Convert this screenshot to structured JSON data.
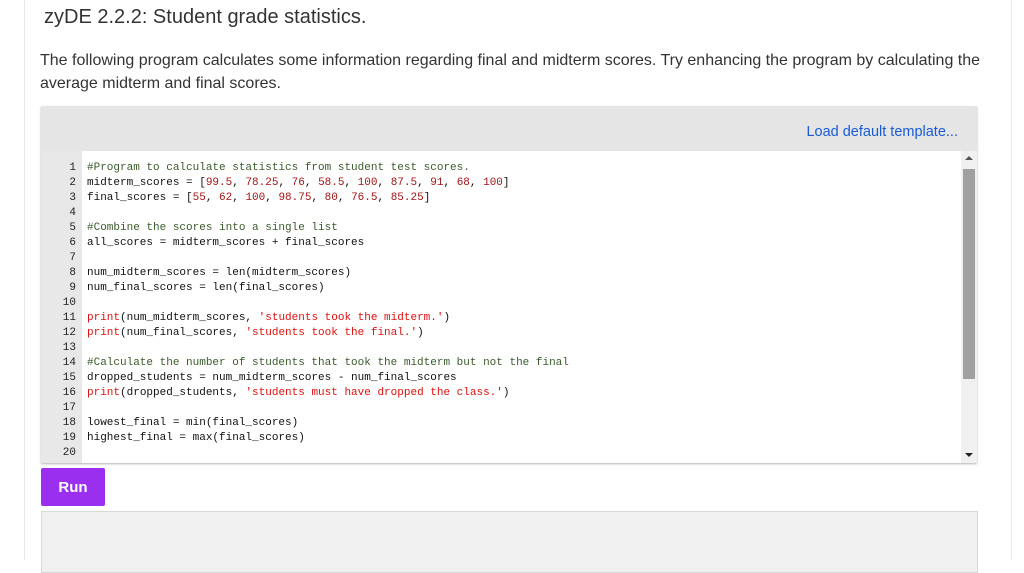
{
  "title": "zyDE 2.2.2: Student grade statistics.",
  "description": "The following program calculates some information regarding final and midterm scores. Try enhancing the program by calculating the average midterm and final scores.",
  "editor": {
    "load_template_label": "Load default template...",
    "lines": [
      [
        [
          "c",
          "#Program to calculate statistics from student test scores."
        ]
      ],
      [
        [
          "p",
          "midterm_scores = ["
        ],
        [
          "n",
          "99.5"
        ],
        [
          "p",
          ", "
        ],
        [
          "n",
          "78.25"
        ],
        [
          "p",
          ", "
        ],
        [
          "n",
          "76"
        ],
        [
          "p",
          ", "
        ],
        [
          "n",
          "58.5"
        ],
        [
          "p",
          ", "
        ],
        [
          "n",
          "100"
        ],
        [
          "p",
          ", "
        ],
        [
          "n",
          "87.5"
        ],
        [
          "p",
          ", "
        ],
        [
          "n",
          "91"
        ],
        [
          "p",
          ", "
        ],
        [
          "n",
          "68"
        ],
        [
          "p",
          ", "
        ],
        [
          "n",
          "100"
        ],
        [
          "p",
          "]"
        ]
      ],
      [
        [
          "p",
          "final_scores = ["
        ],
        [
          "n",
          "55"
        ],
        [
          "p",
          ", "
        ],
        [
          "n",
          "62"
        ],
        [
          "p",
          ", "
        ],
        [
          "n",
          "100"
        ],
        [
          "p",
          ", "
        ],
        [
          "n",
          "98.75"
        ],
        [
          "p",
          ", "
        ],
        [
          "n",
          "80"
        ],
        [
          "p",
          ", "
        ],
        [
          "n",
          "76.5"
        ],
        [
          "p",
          ", "
        ],
        [
          "n",
          "85.25"
        ],
        [
          "p",
          "]"
        ]
      ],
      [],
      [
        [
          "c",
          "#Combine the scores into a single list"
        ]
      ],
      [
        [
          "p",
          "all_scores = midterm_scores + final_scores"
        ]
      ],
      [],
      [
        [
          "p",
          "num_midterm_scores = len(midterm_scores)"
        ]
      ],
      [
        [
          "p",
          "num_final_scores = len(final_scores)"
        ]
      ],
      [],
      [
        [
          "k",
          "print"
        ],
        [
          "p",
          "(num_midterm_scores, "
        ],
        [
          "s",
          "'students took the midterm.'"
        ],
        [
          "p",
          ")"
        ]
      ],
      [
        [
          "k",
          "print"
        ],
        [
          "p",
          "(num_final_scores, "
        ],
        [
          "s",
          "'students took the final.'"
        ],
        [
          "p",
          ")"
        ]
      ],
      [],
      [
        [
          "c",
          "#Calculate the number of students that took the midterm but not the final"
        ]
      ],
      [
        [
          "p",
          "dropped_students = num_midterm_scores - num_final_scores"
        ]
      ],
      [
        [
          "k",
          "print"
        ],
        [
          "p",
          "(dropped_students, "
        ],
        [
          "s",
          "'students must have dropped the class.'"
        ],
        [
          "p",
          ")"
        ]
      ],
      [],
      [
        [
          "p",
          "lowest_final = min(final_scores)"
        ]
      ],
      [
        [
          "p",
          "highest_final = max(final_scores)"
        ]
      ],
      []
    ]
  },
  "run_label": "Run",
  "colors": {
    "accent": "#9b2ff0",
    "link": "#1a5bd6"
  }
}
